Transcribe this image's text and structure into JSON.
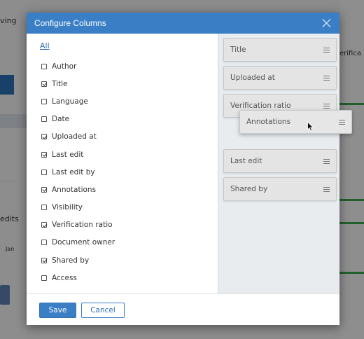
{
  "background": {
    "partial_text_1": "ving",
    "partial_text_2": "edits",
    "partial_text_3": "Jan",
    "partial_text_4": "erifica"
  },
  "dialog": {
    "title": "Configure Columns",
    "all_link": "All",
    "options": [
      {
        "label": "Author",
        "checked": false
      },
      {
        "label": "Title",
        "checked": true
      },
      {
        "label": "Language",
        "checked": false
      },
      {
        "label": "Date",
        "checked": false
      },
      {
        "label": "Uploaded at",
        "checked": true
      },
      {
        "label": "Last edit",
        "checked": true
      },
      {
        "label": "Last edit by",
        "checked": false
      },
      {
        "label": "Annotations",
        "checked": true
      },
      {
        "label": "Visibility",
        "checked": false
      },
      {
        "label": "Verification ratio",
        "checked": true
      },
      {
        "label": "Document owner",
        "checked": false
      },
      {
        "label": "Shared by",
        "checked": true
      },
      {
        "label": "Access",
        "checked": false
      }
    ],
    "selected_columns": [
      {
        "label": "Title"
      },
      {
        "label": "Uploaded at"
      },
      {
        "label": "Verification ratio"
      },
      {
        "label": ""
      },
      {
        "label": "Last edit"
      },
      {
        "label": "Shared by"
      }
    ],
    "dragging_column": "Annotations",
    "save_label": "Save",
    "cancel_label": "Cancel"
  },
  "colors": {
    "header_blue": "#3a7fc6",
    "link_blue": "#2a6fb4",
    "panel_bg": "#e8ecef"
  }
}
